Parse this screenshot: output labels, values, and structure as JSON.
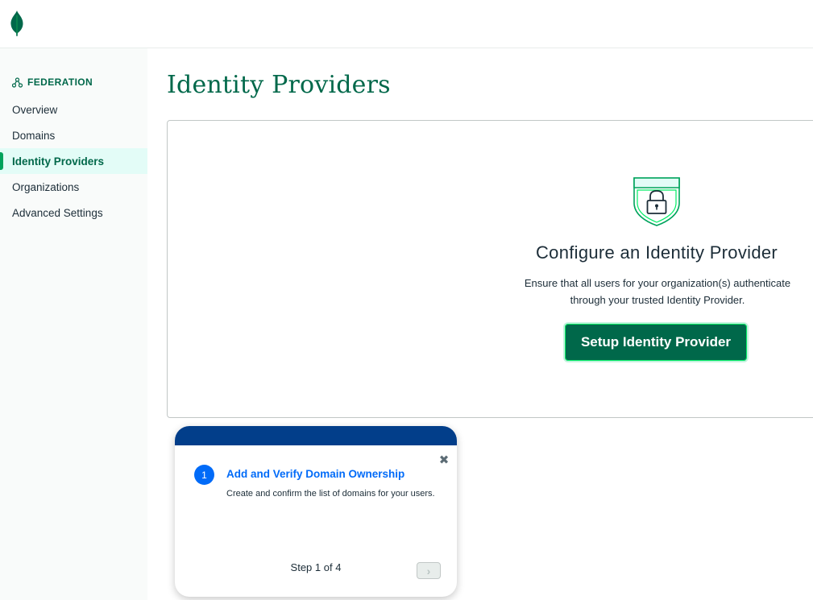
{
  "icons": {
    "logo": "mongodb-leaf-icon",
    "federation": "federation-nodes-icon",
    "shield": "shield-lock-icon",
    "close": "close-icon",
    "next": "chevron-right-icon"
  },
  "colors": {
    "brand_green": "#00684a",
    "accent_green": "#00a35c",
    "active_bg": "#e3fcf7",
    "guide_header": "#023e8a",
    "link_blue": "#016bf8"
  },
  "sidebar": {
    "section_title": "FEDERATION",
    "items": [
      {
        "label": "Overview",
        "active": false
      },
      {
        "label": "Domains",
        "active": false
      },
      {
        "label": "Identity Providers",
        "active": true
      },
      {
        "label": "Organizations",
        "active": false
      },
      {
        "label": "Advanced Settings",
        "active": false
      }
    ]
  },
  "main": {
    "title": "Identity Providers",
    "card": {
      "heading": "Configure an Identity Provider",
      "description_line1": "Ensure that all users for your organization(s) authenticate",
      "description_line2": "through your trusted Identity Provider.",
      "button_label": "Setup Identity Provider"
    }
  },
  "guide": {
    "step_number": "1",
    "title": "Add and Verify Domain Ownership",
    "description": "Create and confirm the list of domains for your users.",
    "step_counter": "Step 1 of 4",
    "close_glyph": "✖",
    "next_glyph": "›"
  }
}
